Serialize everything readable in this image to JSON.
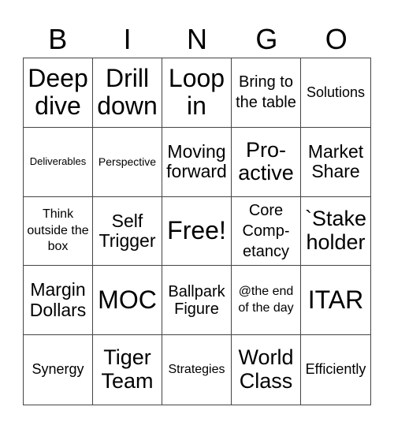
{
  "title_letters": [
    "B",
    "I",
    "N",
    "G",
    "O"
  ],
  "cells": [
    "Deep dive",
    "Drill down",
    "Loop in",
    "Bring to the table",
    "Solutions",
    "Deliverables",
    "Perspective",
    "Moving forward",
    "Pro- active",
    "Market Share",
    "Think outside the box",
    "Self Trigger",
    "Free!",
    "Core Comp- etancy",
    "`Stake holder",
    "Margin Dollars",
    "MOC",
    "Ballpark Figure",
    "@the end of the day",
    "ITAR",
    "Synergy",
    "Tiger Team",
    "Strategies",
    "World Class",
    "Efficiently"
  ]
}
